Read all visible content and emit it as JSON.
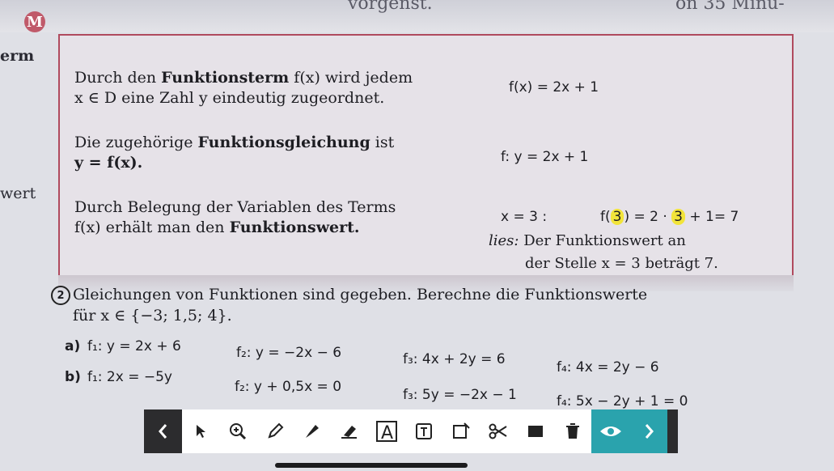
{
  "top": {
    "left_fragment": "vorgenst.",
    "right_fragment": "on 35 Minu-"
  },
  "badge": {
    "letter": "M"
  },
  "margin": {
    "erm": "erm",
    "wert": "wert"
  },
  "definition": {
    "row1_text_a": "Durch den ",
    "row1_bold": "Funktionsterm",
    "row1_text_b": " f(x) wird jedem",
    "row1_line2": "x ∈ D eine Zahl y eindeutig zugeordnet.",
    "row1_example": "f(x) = 2x + 1",
    "row2_text_a": "Die zugehörige ",
    "row2_bold": "Funktionsgleichung",
    "row2_text_b": " ist",
    "row2_line2": "y = f(x).",
    "row2_example": "f: y = 2x + 1",
    "row3_line1": "Durch Belegung der Variablen des Terms",
    "row3_line2_a": "f(x) erhält man den ",
    "row3_line2_bold": "Funktionswert.",
    "row3_x": "x = 3 :",
    "row3_calc_a": "f(",
    "row3_calc_hl1": "3",
    "row3_calc_b": ") = 2 · ",
    "row3_calc_hl2": "3",
    "row3_calc_c": " + 1= 7",
    "row3_read1_it": "lies:",
    "row3_read1": " Der Funktionswert an",
    "row3_read2": "der Stelle x = 3 beträgt 7."
  },
  "task": {
    "number": "2",
    "line1": "Gleichungen von Funktionen sind gegeben. Berechne die Funktionswerte",
    "line2": "für x ∈ {−3; 1,5; 4}.",
    "a": {
      "label": "a)",
      "eqs": [
        "f₁: y = 2x + 6",
        "f₂: y = −2x − 6",
        "f₃: 4x + 2y = 6",
        "f₄: 4x = 2y − 6"
      ]
    },
    "b": {
      "label": "b)",
      "eqs": [
        "f₁: 2x = −5y",
        "f₂: y + 0,5x = 0",
        "f₃: 5y = −2x − 1",
        "f₄: 5x − 2y + 1 = 0"
      ]
    }
  },
  "toolbar": {
    "tools": [
      "back-chevron-icon",
      "pointer-icon",
      "zoom-in-icon",
      "pen-icon",
      "highlighter-icon",
      "eraser-icon",
      "text-box-icon",
      "text-field-icon",
      "shape-icon",
      "scissors-icon",
      "color-swatch-icon",
      "trash-icon",
      "eye-icon",
      "forward-chevron-icon"
    ],
    "selected_tool": "eye-icon",
    "accent_color": "#2aa3ad"
  }
}
